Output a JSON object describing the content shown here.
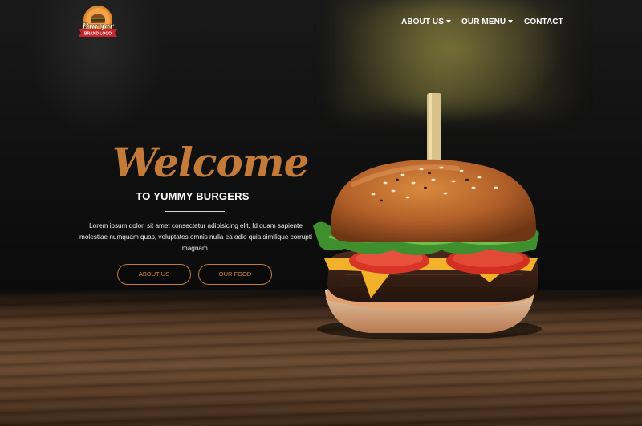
{
  "logo": {
    "text": "Burger",
    "tagline": "BRAND LOGO",
    "colors": {
      "circle": "#e0872f",
      "ribbon": "#c8262b"
    }
  },
  "nav": {
    "items": [
      {
        "label": "ABOUT US",
        "has_dropdown": true
      },
      {
        "label": "OUR MENU",
        "has_dropdown": true
      },
      {
        "label": "CONTACT",
        "has_dropdown": false
      }
    ]
  },
  "hero": {
    "title": "Welcome",
    "subtitle": "TO YUMMY BURGERS",
    "body": "Lorem ipsum dolor, sit amet consectetur adipisicing elit. Id quam sapiente molestiae numquam quas, voluptates omnis nulla ea odio quia similique corrupti magnam.",
    "buttons": [
      {
        "label": "ABOUT US"
      },
      {
        "label": "OUR FOOD"
      }
    ]
  },
  "colors": {
    "accent": "#c47b39",
    "background": "#0c0b0b",
    "text": "#ffffff"
  },
  "image": {
    "subject": "burger-photo"
  }
}
